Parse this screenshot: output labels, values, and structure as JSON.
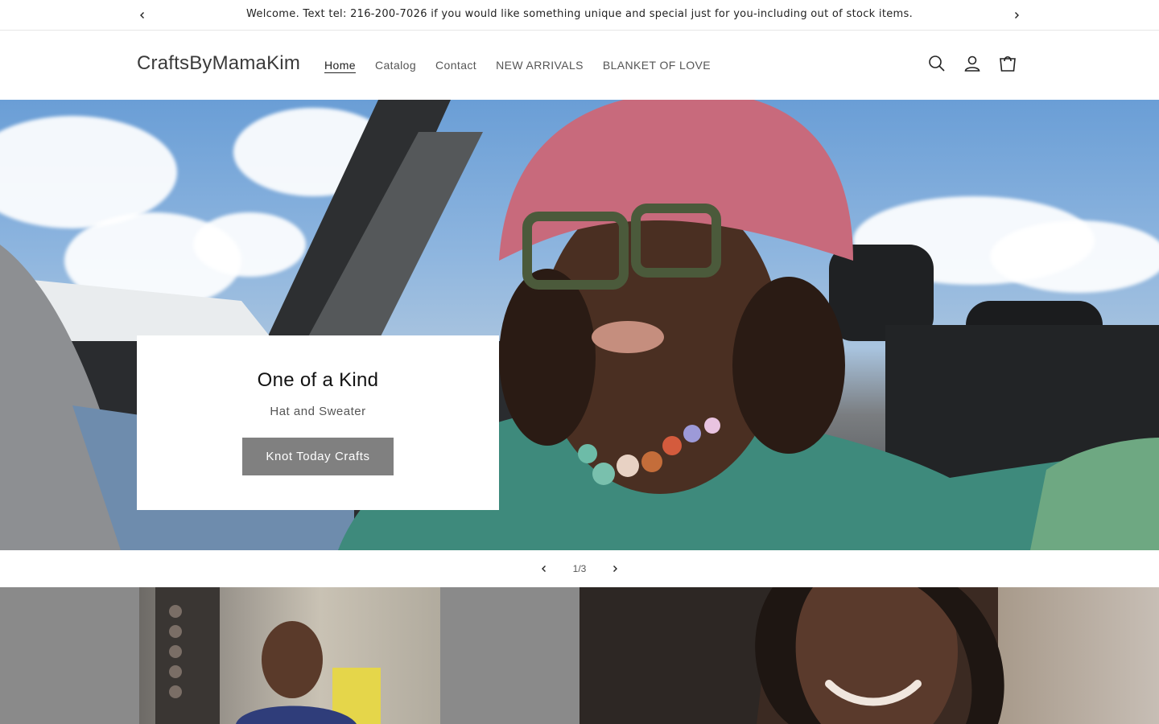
{
  "announcement": {
    "text": "Welcome. Text tel: 216-200-7026 if you would like something unique and special just for you-including out of stock items.",
    "prev_icon": "chevron-left-icon",
    "next_icon": "chevron-right-icon"
  },
  "header": {
    "logo": "CraftsByMamaKim",
    "nav": [
      {
        "label": "Home",
        "active": true
      },
      {
        "label": "Catalog"
      },
      {
        "label": "Contact"
      },
      {
        "label": "NEW ARRIVALS"
      },
      {
        "label": "BLANKET OF LOVE"
      }
    ],
    "icons": [
      "search-icon",
      "account-icon",
      "cart-icon"
    ]
  },
  "hero": {
    "title": "One of a Kind",
    "subtitle": "Hat and Sweater",
    "button_label": "Knot Today Crafts",
    "button_color": "#808080"
  },
  "slideshow": {
    "counter_current": "1",
    "counter_sep": "/",
    "counter_total": "3"
  }
}
